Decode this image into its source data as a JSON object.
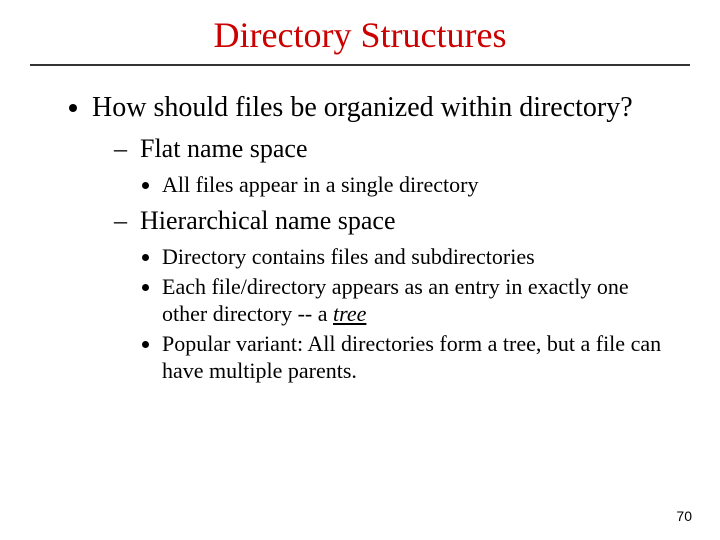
{
  "title": {
    "text": "Directory Structures",
    "color": "#cc0000"
  },
  "bullets": {
    "l1": "How should files be organized within directory?",
    "l2a": "Flat name space",
    "l2a_sub1": "All files appear in a single directory",
    "l2b": "Hierarchical name space",
    "l2b_sub1": "Directory contains files and subdirectories",
    "l2b_sub2_pre": "Each file/directory appears as an entry in exactly one other directory -- a ",
    "l2b_sub2_term": "tree",
    "l2b_sub3": "Popular variant:  All directories form a tree, but a file can have multiple parents."
  },
  "page_number": "70"
}
